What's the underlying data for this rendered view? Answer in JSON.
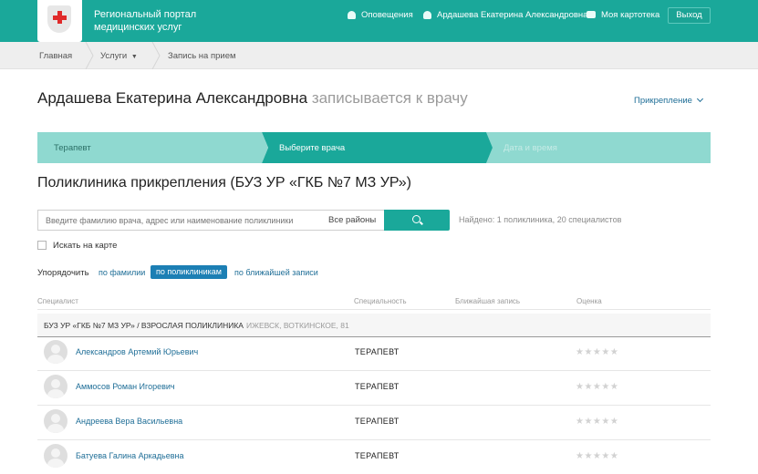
{
  "header": {
    "portal_title": "Региональный портал медицинских услуг",
    "notifications": "Оповещения",
    "user_name": "Ардашева Екатерина Александровна",
    "my_card": "Моя картотека",
    "logout": "Выход",
    "brand_color": "#1aa89a"
  },
  "nav": {
    "home": "Главная",
    "services": "Услуги",
    "appointment": "Запись на прием"
  },
  "page": {
    "patient_name": "Ардашева Екатерина Александровна",
    "title_suffix": "записывается к врачу",
    "attachment_link": "Прикрепление"
  },
  "steps": [
    {
      "label": "Терапевт",
      "state": "done"
    },
    {
      "label": "Выберите врача",
      "state": "active"
    },
    {
      "label": "Дата и время",
      "state": "pending"
    }
  ],
  "clinic_title": "Поликлиника прикрепления (БУЗ УР «ГКБ №7 МЗ УР»)",
  "search": {
    "placeholder": "Введите фамилию врача, адрес или наименование поликлиники",
    "region": "Все районы",
    "found_text": "Найдено: 1 поликлиника, 20 специалистов",
    "map_checkbox_label": "Искать на карте",
    "map_checked": false
  },
  "sort": {
    "label": "Упорядочить",
    "options": [
      "по фамилии",
      "по поликлиникам",
      "по ближайшей записи"
    ],
    "selected": "по поликлиникам"
  },
  "table": {
    "columns": [
      "Специалист",
      "Специальность",
      "Ближайшая запись",
      "Оценка"
    ],
    "group": {
      "name": "БУЗ УР «ГКБ №7 МЗ УР» / ВЗРОСЛАЯ ПОЛИКЛИНИКА",
      "address": "ИЖЕВСК, ВОТКИНСКОЕ, 81"
    },
    "rows": [
      {
        "name": "Александров Артемий Юрьевич",
        "specialty": "ТЕРАПЕВТ",
        "nearest": "",
        "rating": 0,
        "stars": "★★★★★"
      },
      {
        "name": "Аммосов Роман Игоревич",
        "specialty": "ТЕРАПЕВТ",
        "nearest": "",
        "rating": 0,
        "stars": "★★★★★"
      },
      {
        "name": "Андреева Вера Васильевна",
        "specialty": "ТЕРАПЕВТ",
        "nearest": "",
        "rating": 0,
        "stars": "★★★★★"
      },
      {
        "name": "Батуева Галина Аркадьевна",
        "specialty": "ТЕРАПЕВТ",
        "nearest": "",
        "rating": 0,
        "stars": "★★★★★"
      }
    ]
  }
}
